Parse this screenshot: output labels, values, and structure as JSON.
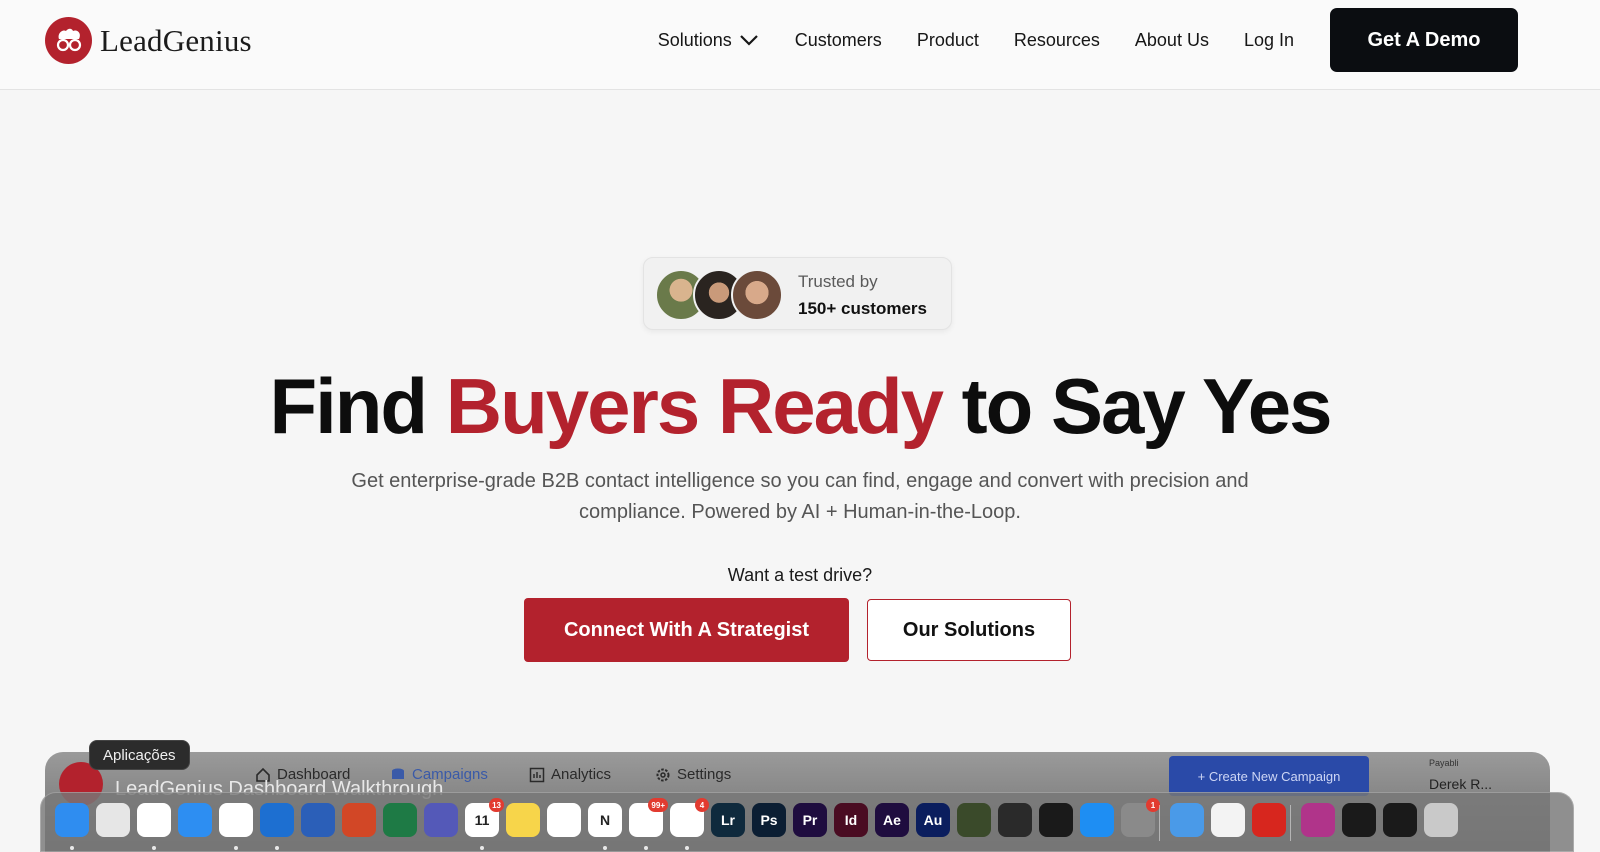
{
  "header": {
    "brand": "LeadGenius",
    "nav": [
      {
        "label": "Solutions",
        "has_dropdown": true
      },
      {
        "label": "Customers"
      },
      {
        "label": "Product"
      },
      {
        "label": "Resources"
      },
      {
        "label": "About Us"
      },
      {
        "label": "Log In"
      }
    ],
    "cta_label": "Get A Demo"
  },
  "trust_badge": {
    "line1": "Trusted by",
    "line2": "150+ customers"
  },
  "hero": {
    "title_part1": "Find ",
    "title_accent": "Buyers Ready",
    "title_part2": " to Say Yes",
    "subtitle_line1": "Get enterprise-grade B2B contact intelligence so you can find, engage and convert with precision and",
    "subtitle_line2": "compliance. Powered by AI + Human-in-the-Loop.",
    "test_drive": "Want a test drive?",
    "primary_button": "Connect With A Strategist",
    "secondary_button": "Our Solutions"
  },
  "preview": {
    "brand": "LeadGenius",
    "video_title": "LeadGenius Dashboard Walkthrough",
    "nav": [
      "Dashboard",
      "Campaigns",
      "Analytics",
      "Settings"
    ],
    "create_button": "+ Create New Campaign",
    "user_small": "Payabli",
    "user_name": "Derek R..."
  },
  "dock": {
    "tooltip": "Aplicações",
    "apps": [
      {
        "name": "finder-icon",
        "color": "#2f8df0",
        "label": ""
      },
      {
        "name": "launchpad-icon",
        "color": "#e6e6e6",
        "label": ""
      },
      {
        "name": "chatgpt-icon",
        "color": "#ffffff",
        "label": ""
      },
      {
        "name": "safari-icon",
        "color": "#2d8ef2",
        "label": ""
      },
      {
        "name": "chrome-icon",
        "color": "#ffffff",
        "label": ""
      },
      {
        "name": "outlook-icon",
        "color": "#1d6fd1",
        "label": ""
      },
      {
        "name": "word-icon",
        "color": "#2b5fb8",
        "label": ""
      },
      {
        "name": "powerpoint-icon",
        "color": "#d24726",
        "label": ""
      },
      {
        "name": "excel-icon",
        "color": "#1e7a45",
        "label": ""
      },
      {
        "name": "teams-icon",
        "color": "#5459b8",
        "label": ""
      },
      {
        "name": "calendar-icon",
        "color": "#ffffff",
        "label": "11",
        "badge": "13"
      },
      {
        "name": "notes-icon",
        "color": "#f7d54a",
        "label": ""
      },
      {
        "name": "reminders-icon",
        "color": "#ffffff",
        "label": ""
      },
      {
        "name": "notion-icon",
        "color": "#ffffff",
        "label": "N"
      },
      {
        "name": "send-icon",
        "color": "#ffffff",
        "label": "",
        "badge": "99+"
      },
      {
        "name": "slack-icon",
        "color": "#ffffff",
        "label": "",
        "badge": "4"
      },
      {
        "name": "lightroom-icon",
        "color": "#0f2a3d",
        "label": "Lr"
      },
      {
        "name": "photoshop-icon",
        "color": "#0b1e33",
        "label": "Ps"
      },
      {
        "name": "premiere-icon",
        "color": "#1f0d3f",
        "label": "Pr"
      },
      {
        "name": "indesign-icon",
        "color": "#4a0c22",
        "label": "Id"
      },
      {
        "name": "aftereffects-icon",
        "color": "#1f0d3f",
        "label": "Ae"
      },
      {
        "name": "audition-icon",
        "color": "#0b1e5e",
        "label": "Au"
      },
      {
        "name": "globe-app-icon",
        "color": "#3a4a2a",
        "label": ""
      },
      {
        "name": "fl-studio-icon",
        "color": "#2a2a2a",
        "label": ""
      },
      {
        "name": "tomorrowland-icon",
        "color": "#1a1a1a",
        "label": ""
      },
      {
        "name": "app-store-icon",
        "color": "#1e8ef3",
        "label": ""
      },
      {
        "name": "system-settings-icon",
        "color": "#8a8a8a",
        "label": "",
        "badge": "1"
      },
      {
        "name": "disk-utility-icon",
        "color": "#4a9ae8",
        "label": ""
      },
      {
        "name": "numbers-sheet-icon",
        "color": "#f3f3f3",
        "label": ""
      },
      {
        "name": "acrobat-icon",
        "color": "#d7261e",
        "label": ""
      },
      {
        "name": "recent-app-icon",
        "color": "#b0348a",
        "label": ""
      },
      {
        "name": "window-thumbnail-icon",
        "color": "#1a1a1a",
        "label": ""
      },
      {
        "name": "window-thumbnail-icon",
        "color": "#1a1a1a",
        "label": ""
      },
      {
        "name": "trash-icon",
        "color": "#c9c9c9",
        "label": ""
      }
    ]
  }
}
